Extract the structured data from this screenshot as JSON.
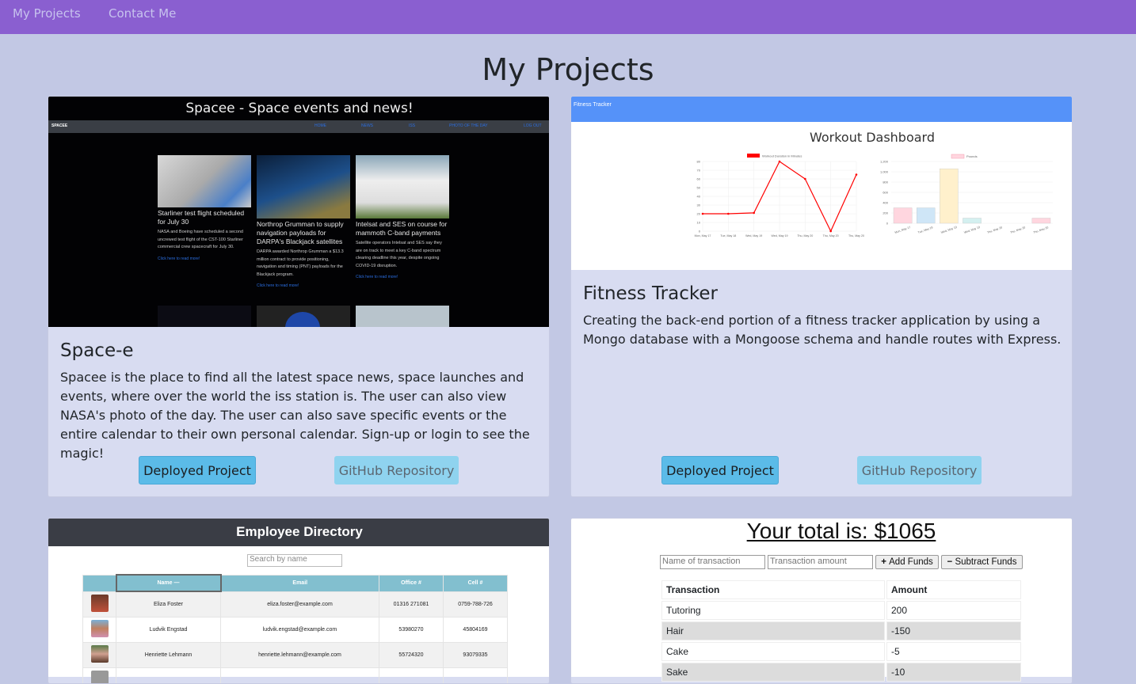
{
  "nav": {
    "items": [
      "My Projects",
      "Contact Me"
    ]
  },
  "page_title": "My Projects",
  "projects": [
    {
      "title": "Space-e",
      "description": "Spacee is the place to find all the latest space news, space launches and events, where over the world the iss station is. The user can also view NASA's photo of the day. The user can also save specific events or the entire calendar to their own personal calendar. Sign-up or login to see the magic!",
      "deployed_label": "Deployed Project",
      "github_label": "GitHub Repository",
      "preview": {
        "title": "Spacee - Space events and news!",
        "brand": "SPACEE",
        "nav": [
          "HOME",
          "NEWS",
          "ISS",
          "PHOTO OF THE DAY",
          "LOG OUT"
        ],
        "articles": [
          {
            "title": "Starliner test flight scheduled for July 30",
            "body": "NASA and Boeing have scheduled a second uncrewed test flight of the CST-100 Starliner commercial crew spacecraft for July 30.",
            "link": "Click here to read more!"
          },
          {
            "title": "Northrop Grumman to supply navigation payloads for DARPA's Blackjack satellites",
            "body": "DARPA awarded Northrop Grumman a $13.3 million contract to provide positioning, navigation and timing (PNT) payloads for the Blackjack program.",
            "link": "Click here to read more!"
          },
          {
            "title": "Intelsat and SES on course for mammoth C-band payments",
            "body": "Satellite operators Intelsat and SES say they are on track to meet a key C-band spectrum clearing deadline this year, despite ongoing COVID-19 disruption.",
            "link": "Click here to read more!"
          }
        ]
      }
    },
    {
      "title": "Fitness Tracker",
      "description": "Creating the back-end portion of a fitness tracker application by using a Mongo database with a Mongoose schema and handle routes with Express.",
      "deployed_label": "Deployed Project",
      "github_label": "GitHub Repository",
      "preview": {
        "brand": "Fitness Tracker",
        "heading": "Workout Dashboard",
        "line_chart": {
          "legend": "Workout Duration in Minutes",
          "color": "#ff0000",
          "categories": [
            "Mon, May 17",
            "Tue, May 18",
            "Wed, May 19",
            "Wed, May 19",
            "Thu, May 20",
            "Thu, May 20",
            "Thu, May 20"
          ],
          "values": [
            20,
            20,
            21,
            80,
            60,
            0,
            65
          ],
          "ylim": [
            0,
            80
          ],
          "yticks": [
            0,
            10,
            20,
            30,
            40,
            50,
            60,
            70,
            80
          ]
        },
        "bar_chart": {
          "legend": "Pounds",
          "categories": [
            "Mon, May 17",
            "Tue, May 18",
            "Wed, May 19",
            "Wed, May 19",
            "Thu, May 20",
            "Thu, May 20",
            "Thu, May 20"
          ],
          "values": [
            300,
            300,
            1060,
            100,
            0,
            0,
            100
          ],
          "colors": [
            "#ffd6df",
            "#cfe6f7",
            "#fff0cc",
            "#d4f0f0",
            "#e6dcff",
            "#ffe4cc",
            "#ffd6df"
          ],
          "ylim": [
            0,
            1200
          ],
          "yticks": [
            "0",
            "200",
            "400",
            "600",
            "800",
            "1,000",
            "1,200"
          ]
        }
      }
    },
    {
      "preview": {
        "title": "Employee Directory",
        "search_placeholder": "Search by name",
        "columns": [
          "",
          "Name —",
          "Email",
          "Office #",
          "Cell #"
        ],
        "rows": [
          [
            "Eliza Foster",
            "eliza.foster@example.com",
            "01316 271081",
            "0759-788-726"
          ],
          [
            "Ludvik Engstad",
            "ludvik.engstad@example.com",
            "53980270",
            "45804169"
          ],
          [
            "Henriette Lehmann",
            "henriette.lehmann@example.com",
            "55724320",
            "93079335"
          ]
        ]
      }
    },
    {
      "preview": {
        "total": "Your total is: $1065",
        "name_placeholder": "Name of transaction",
        "amount_placeholder": "Transaction amount",
        "add_label": "Add Funds",
        "subtract_label": "Subtract Funds",
        "columns": [
          "Transaction",
          "Amount"
        ],
        "rows": [
          [
            "Tutoring",
            "200"
          ],
          [
            "Hair",
            "-150"
          ],
          [
            "Cake",
            "-5"
          ],
          [
            "Sake",
            "-10"
          ]
        ]
      }
    }
  ]
}
